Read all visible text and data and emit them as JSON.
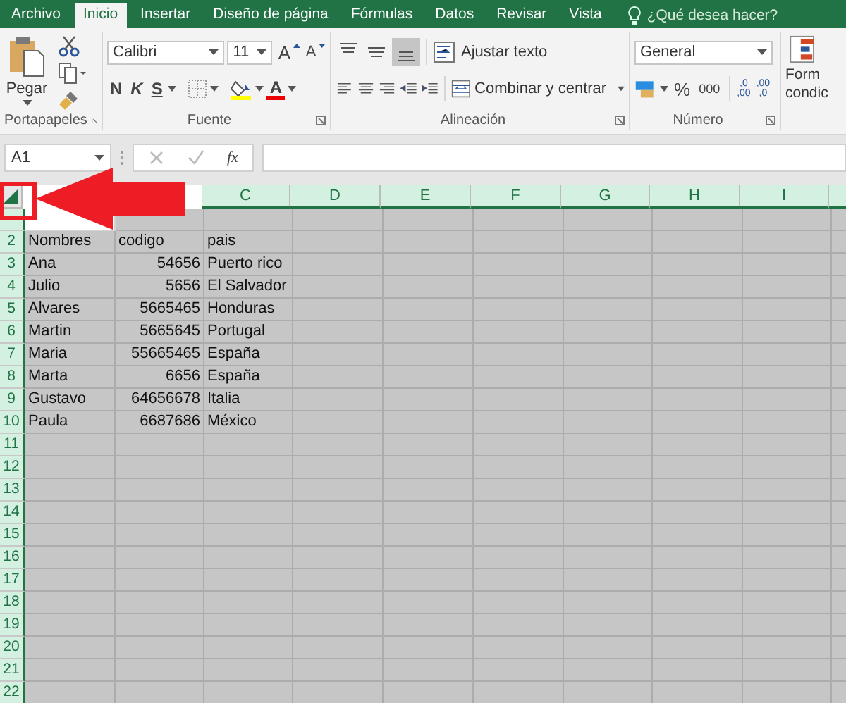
{
  "tabs": [
    {
      "label": "Archivo",
      "selected": false
    },
    {
      "label": "Inicio",
      "selected": true
    },
    {
      "label": "Insertar",
      "selected": false
    },
    {
      "label": "Diseño de página",
      "selected": false
    },
    {
      "label": "Fórmulas",
      "selected": false
    },
    {
      "label": "Datos",
      "selected": false
    },
    {
      "label": "Revisar",
      "selected": false
    },
    {
      "label": "Vista",
      "selected": false
    }
  ],
  "tell_me": {
    "placeholder": "¿Qué desea hacer?"
  },
  "ribbon": {
    "clipboard": {
      "paste": "Pegar",
      "label": "Portapapeles"
    },
    "font": {
      "name": "Calibri",
      "size": "11",
      "grow": "A",
      "shrink": "A",
      "bold": "N",
      "italic": "K",
      "underline": "S",
      "font_color": "A",
      "label": "Fuente"
    },
    "alignment": {
      "wrap": "Ajustar texto",
      "merge": "Combinar y centrar",
      "label": "Alineación",
      "bottom_align_selected": true
    },
    "number": {
      "format": "General",
      "percent": "%",
      "thousands": "000",
      "inc_top": ",0",
      "inc_bottom": ",00",
      "dec_top": ",00",
      "dec_bottom": ",0",
      "label": "Número"
    },
    "conditional": {
      "line_1": "Form",
      "line_2": "condic"
    }
  },
  "formula_bar": {
    "name_box": "A1",
    "fx": "fx"
  },
  "sheet": {
    "columns": [
      {
        "label": "C",
        "selected": true
      },
      {
        "label": "D",
        "selected": true
      },
      {
        "label": "E",
        "selected": true
      },
      {
        "label": "F",
        "selected": true
      },
      {
        "label": "G",
        "selected": true
      },
      {
        "label": "H",
        "selected": true
      },
      {
        "label": "I",
        "selected": true
      },
      {
        "selected": true
      }
    ],
    "first_row": {
      "selected": true,
      "active": true
    },
    "header_row": {
      "number": "2",
      "selected": true,
      "cells": [
        "Nombres",
        "codigo",
        "pais"
      ]
    },
    "rows": [
      {
        "number": "3",
        "selected": true,
        "name": "Ana",
        "code": "54656",
        "country": "Puerto rico"
      },
      {
        "number": "4",
        "selected": true,
        "name": "Julio",
        "code": "5656",
        "country": "El Salvador"
      },
      {
        "number": "5",
        "selected": true,
        "name": "Alvares",
        "code": "5665465",
        "country": "Honduras"
      },
      {
        "number": "6",
        "selected": true,
        "name": "Martin",
        "code": "5665645",
        "country": "Portugal"
      },
      {
        "number": "7",
        "selected": true,
        "name": "Maria",
        "code": "55665465",
        "country": "España"
      },
      {
        "number": "8",
        "selected": true,
        "name": "Marta",
        "code": "6656",
        "country": "España"
      },
      {
        "number": "9",
        "selected": true,
        "name": "Gustavo",
        "code": "64656678",
        "country": "Italia"
      },
      {
        "number": "10",
        "selected": true,
        "name": "Paula",
        "code": "6687686",
        "country": "México"
      },
      {
        "number": "11",
        "selected": true
      },
      {
        "number": "12",
        "selected": true
      },
      {
        "number": "13",
        "selected": true
      },
      {
        "number": "14",
        "selected": true
      },
      {
        "number": "15",
        "selected": true
      },
      {
        "number": "16",
        "selected": true
      },
      {
        "number": "17",
        "selected": true
      },
      {
        "number": "18",
        "selected": true
      },
      {
        "number": "19",
        "selected": true
      },
      {
        "number": "20",
        "selected": true
      },
      {
        "number": "21",
        "selected": true
      },
      {
        "number": "22",
        "selected": true
      }
    ]
  }
}
